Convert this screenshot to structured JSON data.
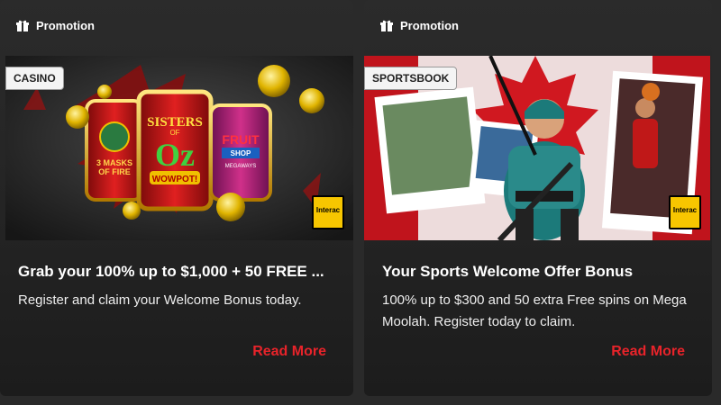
{
  "cards": [
    {
      "header": "Promotion",
      "badge": "CASINO",
      "interac": "Interac",
      "game_titles": [
        "3 MASKS OF FIRE",
        "SISTERS OF OZ WOWPOT!",
        "FRUIT SHOP MEGAWAYS"
      ],
      "title": "Grab your 100% up to $1,000 + 50 FREE ...",
      "description": "Register and claim your Welcome Bonus today.",
      "cta": "Read More"
    },
    {
      "header": "Promotion",
      "badge": "SPORTSBOOK",
      "interac": "Interac",
      "title": "Your Sports Welcome Offer Bonus",
      "description": "100% up to $300 and 50 extra Free spins on Mega Moolah. Register today to claim.",
      "cta": "Read More"
    }
  ],
  "colors": {
    "accent": "#e8232a",
    "background": "#2a2a2a",
    "interac": "#f7c600"
  }
}
